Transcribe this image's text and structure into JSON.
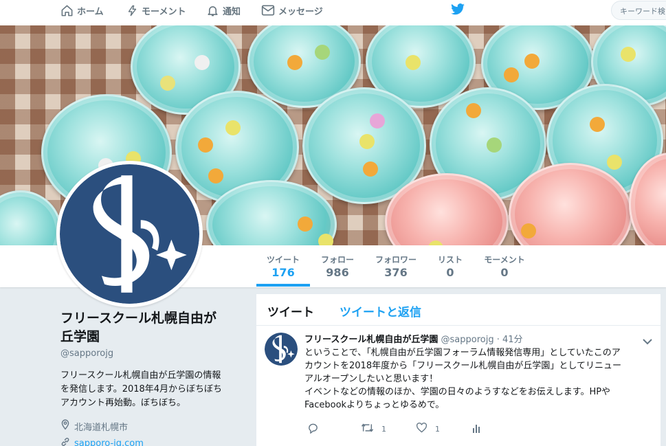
{
  "nav": {
    "home": "ホーム",
    "moments": "モーメント",
    "notifications": "通知",
    "messages": "メッセージ",
    "search_placeholder": "キーワード検"
  },
  "profile_nav": {
    "stats": [
      {
        "label": "ツイート",
        "value": "176"
      },
      {
        "label": "フォロー",
        "value": "986"
      },
      {
        "label": "フォロワー",
        "value": "376"
      },
      {
        "label": "リスト",
        "value": "0"
      },
      {
        "label": "モーメント",
        "value": "0"
      }
    ]
  },
  "profile": {
    "name_line1": "フリースクール札幌自由が",
    "name_line2": "丘学園",
    "handle": "@sapporojg",
    "bio_line1": "フリースクール札幌自由が丘学園の情報",
    "bio_line2": "を発信します。2018年4月からぼちぼち",
    "bio_line3": "アカウント再始動。ぼちぼち。",
    "location": "北海道札幌市",
    "website": "sapporo-jg.com"
  },
  "timeline": {
    "tab_tweets": "ツイート",
    "tab_replies": "ツイートと返信"
  },
  "tweet": {
    "name": "フリースクール札幌自由が丘学園",
    "handle": "@sapporojg",
    "separator": "·",
    "time": "41分",
    "text_line1": "ということで、「札幌自由が丘学園フォーラム情報発信専用」としていたこのア",
    "text_line2": "カウントを2018年度から「フリースクール札幌自由が丘学園」としてリニュー",
    "text_line3": "アルオープンしたいと思います！",
    "text_line4": "イベントなどの情報のほか、学園の日々のようすなどをお伝えします。HPや",
    "text_line5": "Facebookよりちょっとゆるめで。",
    "retweets": "1",
    "likes": "1"
  },
  "colors": {
    "accent": "#1da1f2",
    "logo_navy": "#2b4f7e",
    "text_gray": "#657786"
  },
  "icons": {
    "home": "home-icon",
    "moments": "lightning-icon",
    "notifications": "bell-icon",
    "messages": "envelope-icon",
    "brand": "twitter-bird-icon",
    "location": "location-pin-icon",
    "link": "link-icon",
    "reply": "reply-icon",
    "retweet": "retweet-icon",
    "like": "heart-icon",
    "analytics": "analytics-icon",
    "more": "chevron-down-icon"
  }
}
